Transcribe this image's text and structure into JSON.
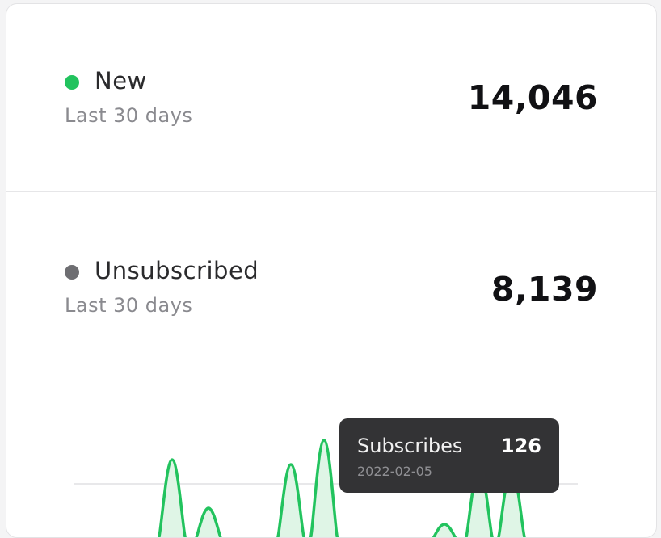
{
  "stats": [
    {
      "label": "New",
      "sublabel": "Last 30 days",
      "value": "14,046",
      "dot_color": "#22c35e"
    },
    {
      "label": "Unsubscribed",
      "sublabel": "Last 30 days",
      "value": "8,139",
      "dot_color": "#6e6e72"
    }
  ],
  "chart": {
    "line_color": "#22c35e",
    "fill_color": "#dff5e6",
    "tooltip": {
      "title": "Subscribes",
      "value": "126",
      "date": "2022-02-05"
    }
  }
}
